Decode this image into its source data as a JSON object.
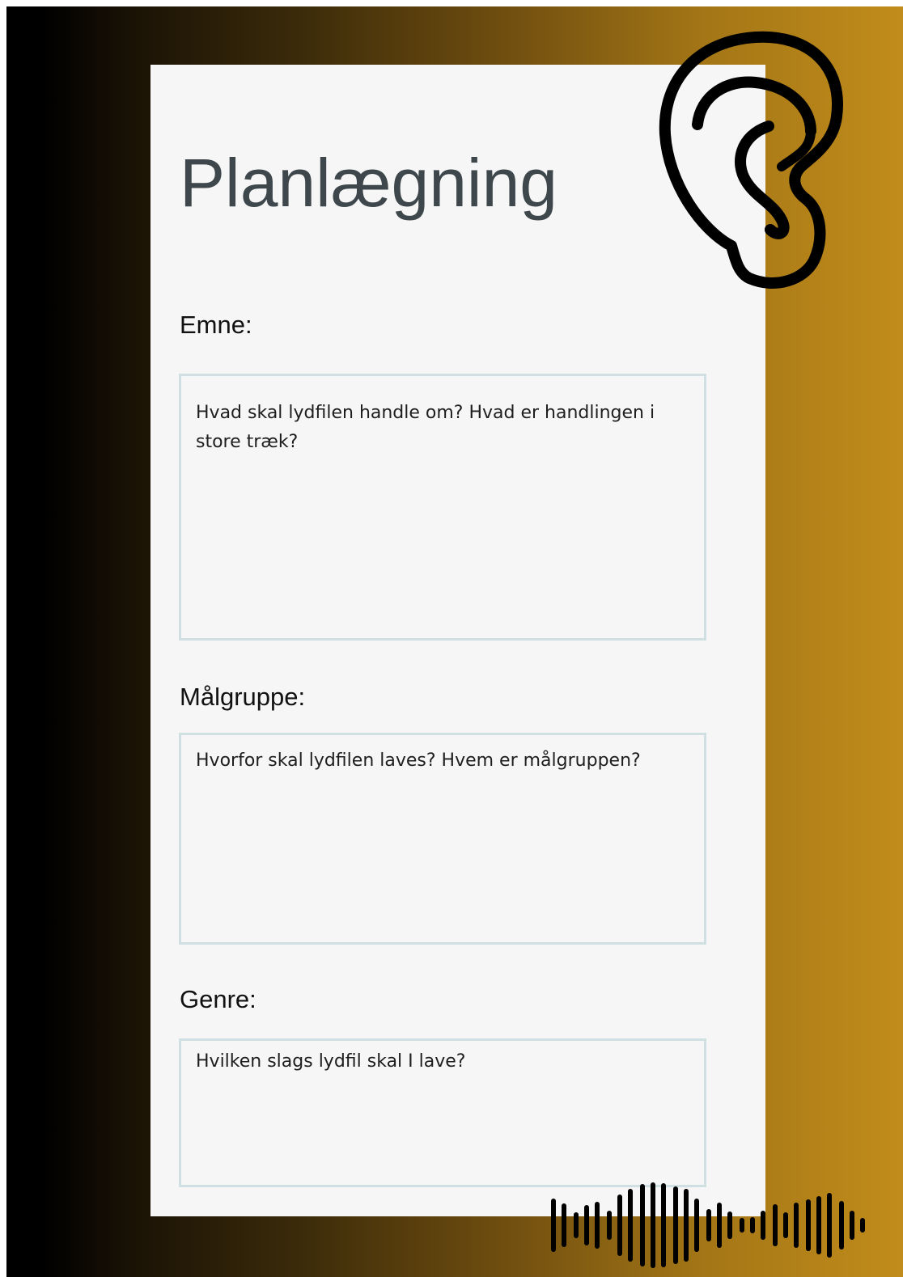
{
  "page": {
    "title": "Planlægning"
  },
  "fields": [
    {
      "label": "Emne:",
      "placeholder": "Hvad skal lydfilen handle om? Hvad er handlingen i store træk?",
      "value": ""
    },
    {
      "label": "Målgruppe:",
      "placeholder": "Hvorfor skal lydfilen laves? Hvem er målgruppen?",
      "value": ""
    },
    {
      "label": "Genre:",
      "placeholder": "Hvilken slags lydfil skal I lave?",
      "value": ""
    }
  ],
  "decorations": {
    "ear_icon": "ear-icon",
    "waveform_icon": "sound-wave-icon"
  },
  "colors": {
    "background_gradient_start": "#000000",
    "background_gradient_end": "#c18c1b",
    "card_background": "#f6f6f6",
    "field_border": "#cfdfe2",
    "title_text": "#3e474c"
  }
}
